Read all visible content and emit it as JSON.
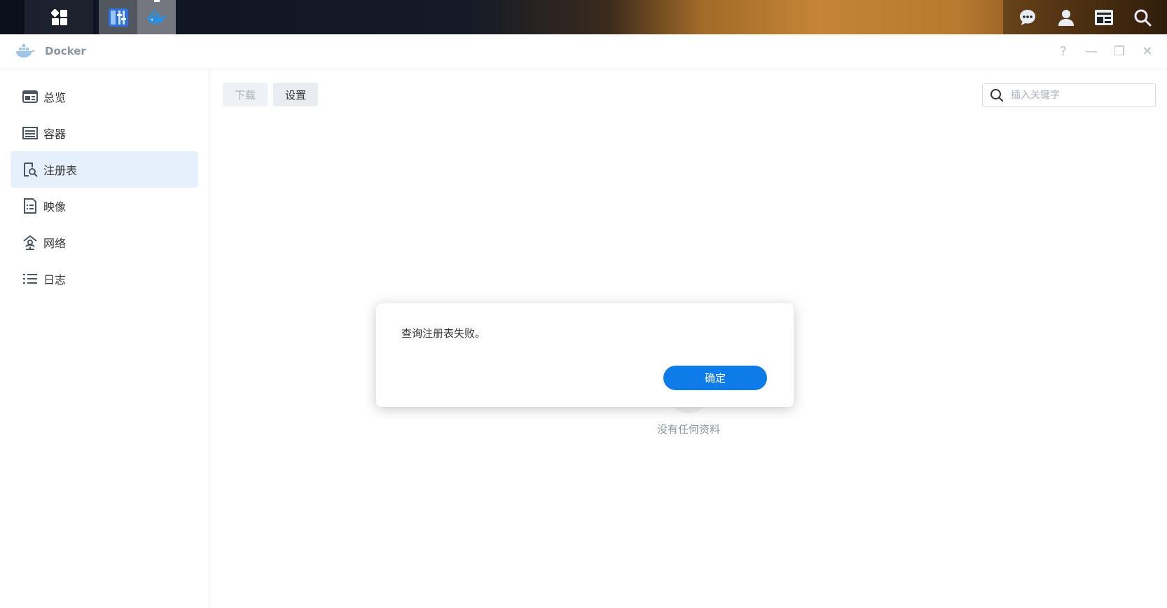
{
  "window": {
    "title": "Docker"
  },
  "taskbar": {
    "apps": [
      "main-menu",
      "control-panel",
      "docker"
    ]
  },
  "window_controls": [
    "?",
    "—",
    "❐",
    "✕"
  ],
  "sidebar": {
    "items": [
      {
        "label": "总览",
        "icon": "overview-icon"
      },
      {
        "label": "容器",
        "icon": "container-icon"
      },
      {
        "label": "注册表",
        "icon": "registry-icon",
        "active": true
      },
      {
        "label": "映像",
        "icon": "image-icon"
      },
      {
        "label": "网络",
        "icon": "network-icon"
      },
      {
        "label": "日志",
        "icon": "log-icon"
      }
    ]
  },
  "toolbar": {
    "download_label": "下载",
    "settings_label": "设置"
  },
  "search": {
    "placeholder": "插入关键字",
    "value": ""
  },
  "empty_state": {
    "text": "没有任何资料"
  },
  "dialog": {
    "message": "查询注册表失败。",
    "ok_label": "确定"
  },
  "colors": {
    "accent": "#0d7ce8",
    "active_bg": "#e5f0fc"
  }
}
